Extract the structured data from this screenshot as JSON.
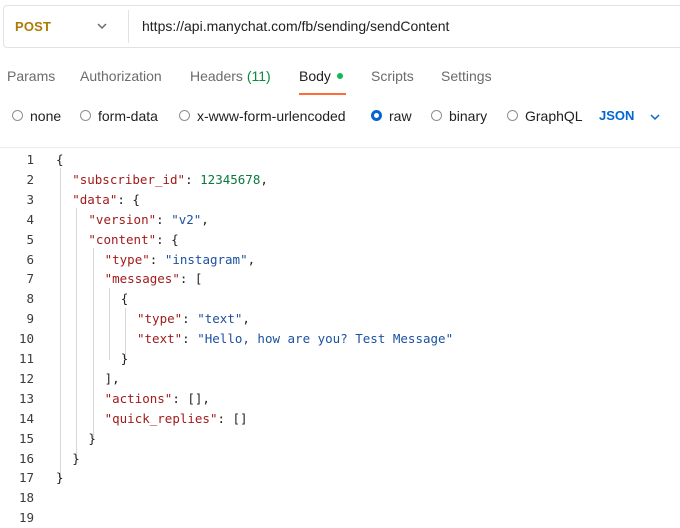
{
  "request": {
    "method": "POST",
    "url": "https://api.manychat.com/fb/sending/sendContent"
  },
  "tabs": {
    "params": "Params",
    "authorization": "Authorization",
    "headers": "Headers",
    "headers_count": "(11)",
    "body": "Body",
    "scripts": "Scripts",
    "settings": "Settings"
  },
  "body_types": {
    "none": "none",
    "form_data": "form-data",
    "urlencoded": "x-www-form-urlencoded",
    "raw": "raw",
    "binary": "binary",
    "graphql": "GraphQL",
    "selected": "raw",
    "format": "JSON"
  },
  "editor": {
    "line_numbers": [
      "1",
      "2",
      "3",
      "4",
      "5",
      "6",
      "7",
      "8",
      "9",
      "10",
      "11",
      "12",
      "13",
      "14",
      "15",
      "16",
      "17",
      "18",
      "19"
    ],
    "lines": [
      [
        {
          "t": "pun",
          "v": "{"
        }
      ],
      [
        {
          "t": "key",
          "v": "\"subscriber_id\""
        },
        {
          "t": "pun",
          "v": ": "
        },
        {
          "t": "num",
          "v": "12345678"
        },
        {
          "t": "pun",
          "v": ","
        }
      ],
      [
        {
          "t": "key",
          "v": "\"data\""
        },
        {
          "t": "pun",
          "v": ": {"
        }
      ],
      [
        {
          "t": "key",
          "v": "\"version\""
        },
        {
          "t": "pun",
          "v": ": "
        },
        {
          "t": "str",
          "v": "\"v2\""
        },
        {
          "t": "pun",
          "v": ","
        }
      ],
      [
        {
          "t": "key",
          "v": "\"content\""
        },
        {
          "t": "pun",
          "v": ": {"
        }
      ],
      [
        {
          "t": "key",
          "v": "\"type\""
        },
        {
          "t": "pun",
          "v": ": "
        },
        {
          "t": "str",
          "v": "\"instagram\""
        },
        {
          "t": "pun",
          "v": ","
        }
      ],
      [
        {
          "t": "key",
          "v": "\"messages\""
        },
        {
          "t": "pun",
          "v": ": ["
        }
      ],
      [
        {
          "t": "pun",
          "v": "{"
        }
      ],
      [
        {
          "t": "key",
          "v": "\"type\""
        },
        {
          "t": "pun",
          "v": ": "
        },
        {
          "t": "str",
          "v": "\"text\""
        },
        {
          "t": "pun",
          "v": ","
        }
      ],
      [
        {
          "t": "key",
          "v": "\"text\""
        },
        {
          "t": "pun",
          "v": ": "
        },
        {
          "t": "str",
          "v": "\"Hello, how are you? Test Message\""
        }
      ],
      [
        {
          "t": "pun",
          "v": "}"
        }
      ],
      [
        {
          "t": "pun",
          "v": "],"
        }
      ],
      [
        {
          "t": "key",
          "v": "\"actions\""
        },
        {
          "t": "pun",
          "v": ": [],"
        }
      ],
      [
        {
          "t": "key",
          "v": "\"quick_replies\""
        },
        {
          "t": "pun",
          "v": ": []"
        }
      ],
      [
        {
          "t": "pun",
          "v": "}"
        }
      ],
      [
        {
          "t": "pun",
          "v": "}"
        }
      ],
      [
        {
          "t": "pun",
          "v": "}"
        }
      ],
      [],
      []
    ]
  },
  "icons": {
    "method_dropdown": "chevron-down-icon",
    "format_dropdown": "chevron-down-icon",
    "body_status": "green-dot-icon"
  },
  "colors": {
    "method": "#ad7a03",
    "accent_underline": "#ff6c37",
    "link_blue": "#0265d2",
    "json_key": "#a11b1b",
    "json_string": "#1c51a0",
    "json_number": "#097a3d",
    "status_dot": "#0cbb52"
  }
}
